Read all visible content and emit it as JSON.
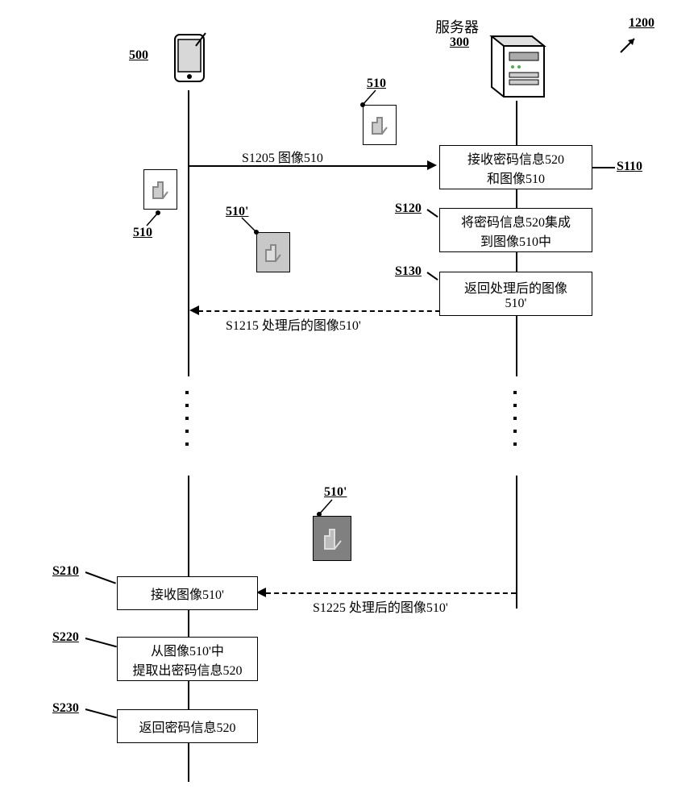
{
  "diagram_id": "1200",
  "server_label": "服务器",
  "server_id": "300",
  "phone_id": "500",
  "image_plain": "510",
  "image_processed": "510'",
  "msg_S1205": "S1205 图像510",
  "msg_S1215": "S1215 处理后的图像510'",
  "msg_S1225": "S1225 处理后的图像510'",
  "step_S110": {
    "id": "S110",
    "line1": "接收密码信息520",
    "line2": "和图像510"
  },
  "step_S120": {
    "id": "S120",
    "line1": "将密码信息520集成",
    "line2": "到图像510中"
  },
  "step_S130": {
    "id": "S130",
    "line1": "返回处理后的图像",
    "line2": "510'"
  },
  "step_S210": {
    "id": "S210",
    "text": "接收图像510'"
  },
  "step_S220": {
    "id": "S220",
    "line1": "从图像510'中",
    "line2": "提取出密码信息520"
  },
  "step_S230": {
    "id": "S230",
    "text": "返回密码信息520"
  },
  "chart_data": {
    "type": "sequence_diagram",
    "participants": [
      {
        "id": "500",
        "role": "client/phone"
      },
      {
        "id": "300",
        "role": "server",
        "label": "服务器"
      }
    ],
    "image_states": [
      {
        "id": "510",
        "desc": "original image"
      },
      {
        "id": "510'",
        "desc": "processed image (password embedded)"
      }
    ],
    "messages": [
      {
        "id": "S1205",
        "from": "500",
        "to": "300",
        "label": "图像510",
        "style": "solid"
      },
      {
        "id": "S1215",
        "from": "300",
        "to": "500",
        "label": "处理后的图像510'",
        "style": "dashed"
      },
      {
        "id": "S1225",
        "from": "300",
        "to": "500",
        "label": "处理后的图像510'",
        "style": "dashed"
      }
    ],
    "server_steps": [
      {
        "id": "S110",
        "text": "接收密码信息520和图像510"
      },
      {
        "id": "S120",
        "text": "将密码信息520集成到图像510中"
      },
      {
        "id": "S130",
        "text": "返回处理后的图像510'"
      }
    ],
    "client_steps": [
      {
        "id": "S210",
        "text": "接收图像510'"
      },
      {
        "id": "S220",
        "text": "从图像510'中提取出密码信息520"
      },
      {
        "id": "S230",
        "text": "返回密码信息520"
      }
    ]
  }
}
